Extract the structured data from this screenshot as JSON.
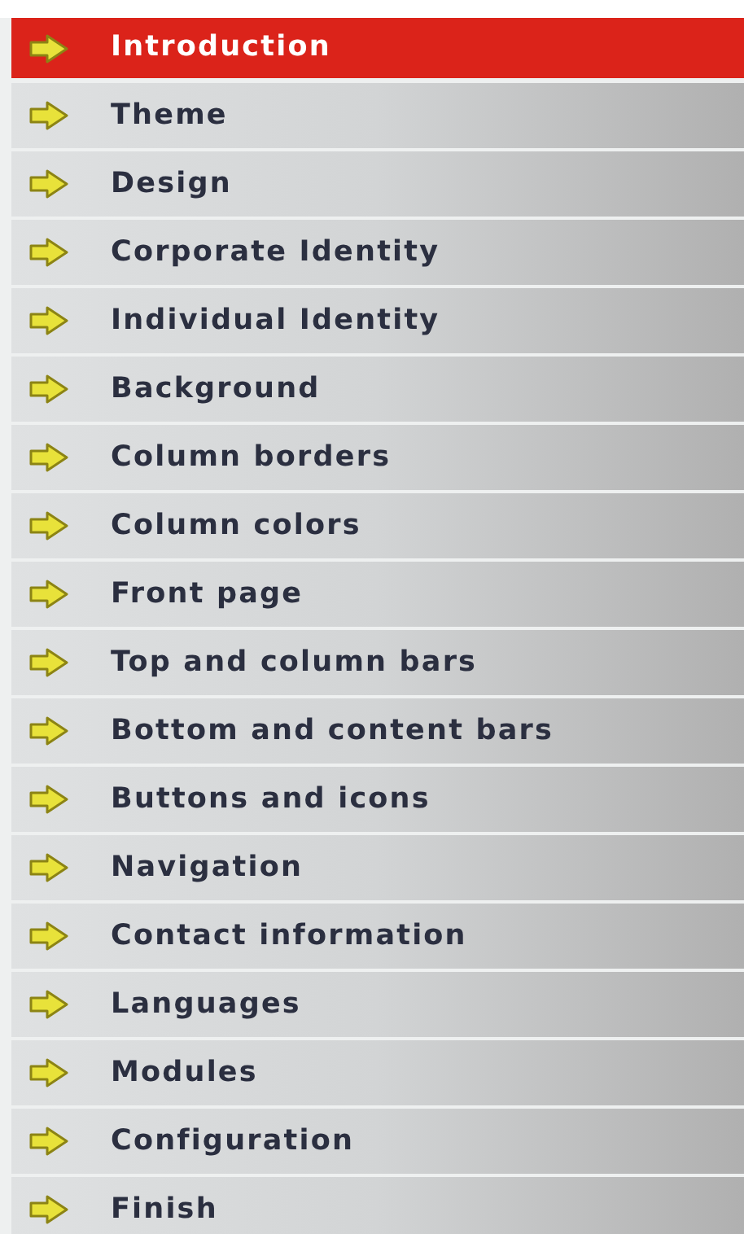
{
  "menu": {
    "items": [
      {
        "label": "Introduction",
        "selected": true
      },
      {
        "label": "Theme",
        "selected": false
      },
      {
        "label": "Design",
        "selected": false
      },
      {
        "label": "Corporate Identity",
        "selected": false
      },
      {
        "label": "Individual Identity",
        "selected": false
      },
      {
        "label": "Background",
        "selected": false
      },
      {
        "label": "Column borders",
        "selected": false
      },
      {
        "label": "Column colors",
        "selected": false
      },
      {
        "label": "Front page",
        "selected": false
      },
      {
        "label": "Top and column bars",
        "selected": false
      },
      {
        "label": "Bottom and content bars",
        "selected": false
      },
      {
        "label": "Buttons and icons",
        "selected": false
      },
      {
        "label": "Navigation",
        "selected": false
      },
      {
        "label": "Contact information",
        "selected": false
      },
      {
        "label": "Languages",
        "selected": false
      },
      {
        "label": "Modules",
        "selected": false
      },
      {
        "label": "Configuration",
        "selected": false
      },
      {
        "label": "Finish",
        "selected": false
      }
    ]
  }
}
